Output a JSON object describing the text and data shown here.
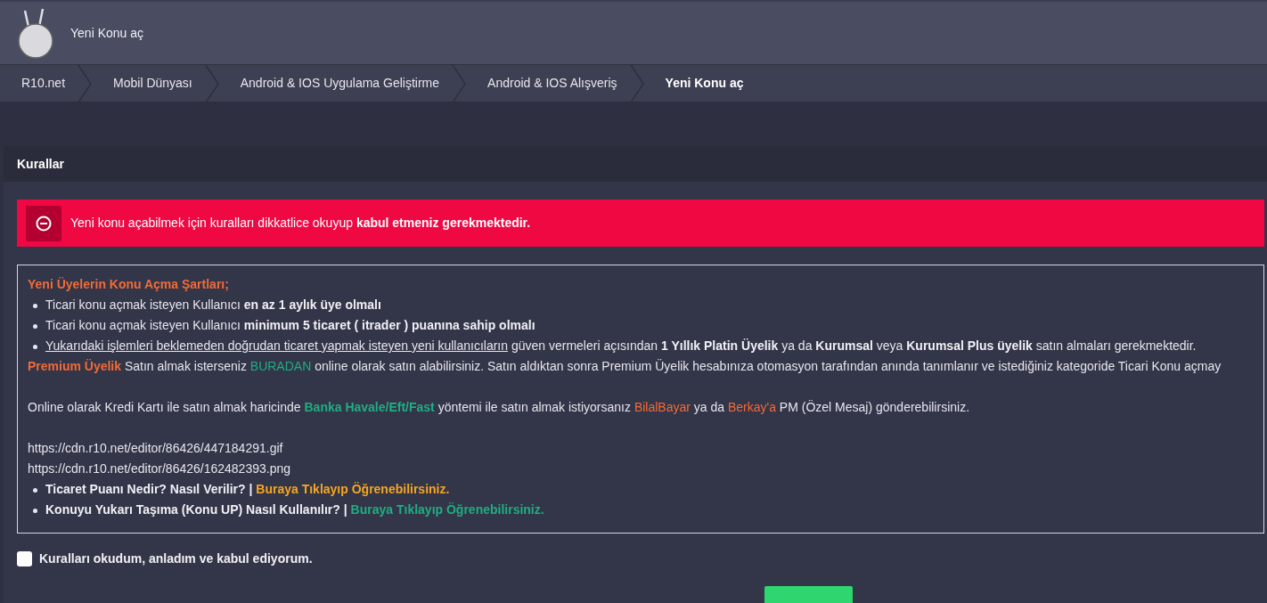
{
  "header": {
    "title": "Yeni Konu aç"
  },
  "breadcrumb": [
    {
      "label": "R10.net",
      "selected": false
    },
    {
      "label": "Mobil Dünyası",
      "selected": false
    },
    {
      "label": "Android & IOS Uygulama Geliştirme",
      "selected": false
    },
    {
      "label": "Android & IOS Alışveriş",
      "selected": false
    },
    {
      "label": "Yeni Konu aç",
      "selected": true
    }
  ],
  "panel": {
    "title": "Kurallar",
    "alert": {
      "text": "Yeni konu açabilmek için kuralları dikkatlice okuyup **kabul etmeniz gerekmektedir.**"
    },
    "rules": [
      {
        "kind": "heading",
        "segments": [
          {
            "kind": "heading",
            "text": "Yeni Üyelerin Konu Açma Şartları;"
          }
        ]
      },
      {
        "kind": "bullet",
        "segments": [
          {
            "kind": "text",
            "text": "Ticari konu açmak isteyen Kullanıcı "
          },
          {
            "kind": "bold",
            "text": "en az 1 aylık üye olmalı"
          }
        ]
      },
      {
        "kind": "bullet",
        "segments": [
          {
            "kind": "text",
            "text": "Ticari konu açmak isteyen Kullanıcı "
          },
          {
            "kind": "bold",
            "text": "minimum 5 ticaret ( itrader ) puanına sahip olmalı"
          }
        ]
      },
      {
        "kind": "bullet",
        "segments": [
          {
            "kind": "underline",
            "text": "Yukarıdaki işlemleri beklemeden doğrudan ticaret yapmak isteyen yeni kullanıcıların"
          },
          {
            "kind": "text",
            "text": " güven vermeleri açısından "
          },
          {
            "kind": "bold",
            "text": "1 Yıllık Platin Üyelik"
          },
          {
            "kind": "text",
            "text": " ya da "
          },
          {
            "kind": "bold",
            "text": "Kurumsal"
          },
          {
            "kind": "text",
            "text": " veya "
          },
          {
            "kind": "bold",
            "text": "Kurumsal Plus üyelik"
          },
          {
            "kind": "text",
            "text": " satın almaları gerekmektedir."
          }
        ]
      },
      {
        "kind": "paragraph",
        "segments": [
          {
            "kind": "link",
            "color": "#f26b38",
            "bold": true,
            "text": "Premium Üyelik"
          },
          {
            "kind": "text",
            "text": " Satın almak isterseniz "
          },
          {
            "kind": "link",
            "color": "#1fae82",
            "bold": false,
            "text": "BURADAN"
          },
          {
            "kind": "text",
            "text": " online olarak satın alabilirsiniz. Satın aldıktan sonra Premium Üyelik hesabınıza otomasyon tarafından anında tanımlanır ve istediğiniz kategoride Ticari Konu açmay"
          }
        ]
      },
      {
        "kind": "gap"
      },
      {
        "kind": "paragraph",
        "segments": [
          {
            "kind": "text",
            "text": "Online olarak Kredi Kartı ile satın almak haricinde "
          },
          {
            "kind": "link",
            "color": "#1fae82",
            "bold": true,
            "text": "Banka Havale/Eft/Fast"
          },
          {
            "kind": "text",
            "text": " yöntemi ile satın almak istiyorsanız "
          },
          {
            "kind": "link",
            "color": "#f26b38",
            "bold": false,
            "text": "BilalBayar"
          },
          {
            "kind": "text",
            "text": " ya da "
          },
          {
            "kind": "link",
            "color": "#f26b38",
            "bold": false,
            "text": "Berkay'a"
          },
          {
            "kind": "text",
            "text": " PM (Özel Mesaj) gönderebilirsiniz."
          }
        ]
      },
      {
        "kind": "gap"
      },
      {
        "kind": "line",
        "segments": [
          {
            "kind": "text",
            "text": "https://cdn.r10.net/editor/86426/447184291.gif"
          }
        ]
      },
      {
        "kind": "line",
        "segments": [
          {
            "kind": "text",
            "text": "https://cdn.r10.net/editor/86426/162482393.png"
          }
        ]
      },
      {
        "kind": "bullet",
        "segments": [
          {
            "kind": "bold",
            "text": "Ticaret Puanı Nedir? Nasıl Verilir? | "
          },
          {
            "kind": "link",
            "color": "#f5a623",
            "bold": true,
            "text": "Buraya Tıklayıp Öğrenebilirsiniz."
          }
        ]
      },
      {
        "kind": "bullet",
        "segments": [
          {
            "kind": "bold",
            "text": "Konuyu Yukarı Taşıma (Konu UP) Nasıl Kullanılır? | "
          },
          {
            "kind": "link",
            "color": "#1fae82",
            "bold": true,
            "text": "Buraya Tıklayıp Öğrenebilirsiniz."
          }
        ]
      }
    ],
    "accept": {
      "label": "Kuralları okudum, anladım ve kabul ediyorum.",
      "checked": false
    }
  }
}
